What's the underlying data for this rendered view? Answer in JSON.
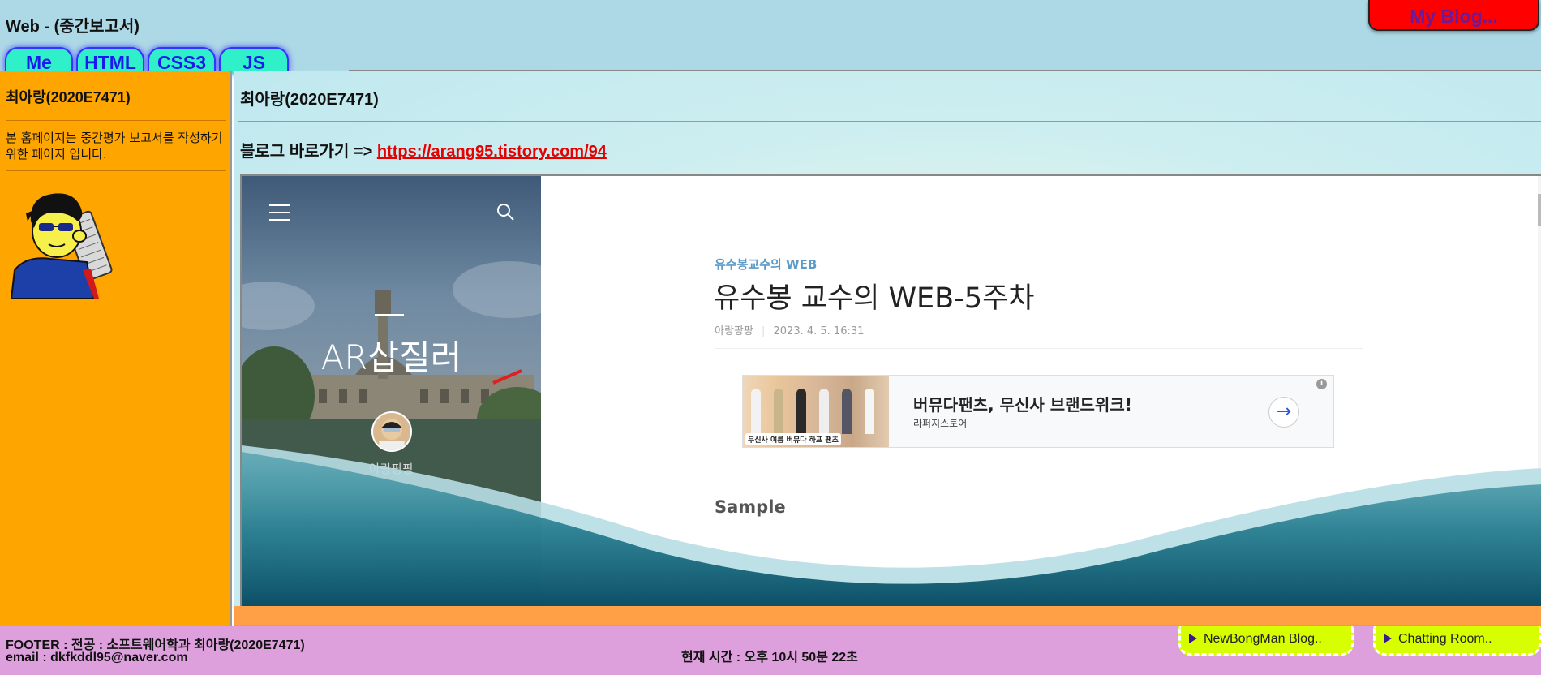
{
  "header": {
    "title": "Web - (중간보고서)",
    "myblog_label": "My Blog...",
    "tabs": [
      {
        "label": "Me"
      },
      {
        "label": "HTML"
      },
      {
        "label": "CSS3"
      },
      {
        "label": "JS"
      }
    ]
  },
  "sidebar": {
    "name": "최아랑(2020E7471)",
    "description": "본 홈페이지는 중간평가 보고서를 작성하기 위한 페이지 입니다."
  },
  "main": {
    "name": "최아랑(2020E7471)",
    "blog_link_prefix": "블로그 바로가기 =>",
    "blog_url": "https://arang95.tistory.com/94"
  },
  "embedded_blog": {
    "blog_name": "AR삽질러",
    "author": "아랑팡팡",
    "post": {
      "category": "유수봉교수의 WEB",
      "title": "유수봉 교수의 WEB-5주차",
      "author": "아랑팡팡",
      "date": "2023. 4. 5. 16:31",
      "section_heading": "Sample"
    },
    "ad": {
      "title": "버뮤다팬츠, 무신사 브랜드위크!",
      "advertiser": "라퍼지스토어",
      "image_badge": "무신사 여름 버뮤다 하프 팬츠"
    }
  },
  "footer": {
    "major": "FOOTER : 전공 : 소프트웨어학과 최아랑(2020E7471)",
    "email": "email : dkfkddl95@naver.com",
    "current_time": "현재 시간 : 오후 10시 50분 22초",
    "links": [
      {
        "label": "NewBongMan Blog.."
      },
      {
        "label": "Chatting Room.."
      }
    ]
  },
  "colors": {
    "header_bg": "#add8e6",
    "sidebar_bg": "#ffa500",
    "footer_bg": "#dda0dd",
    "tab_bg": "#2ff0c8",
    "myblog_bg": "#ff0000",
    "link_color": "#e60000",
    "footer_link_bg": "#d8ff00"
  }
}
